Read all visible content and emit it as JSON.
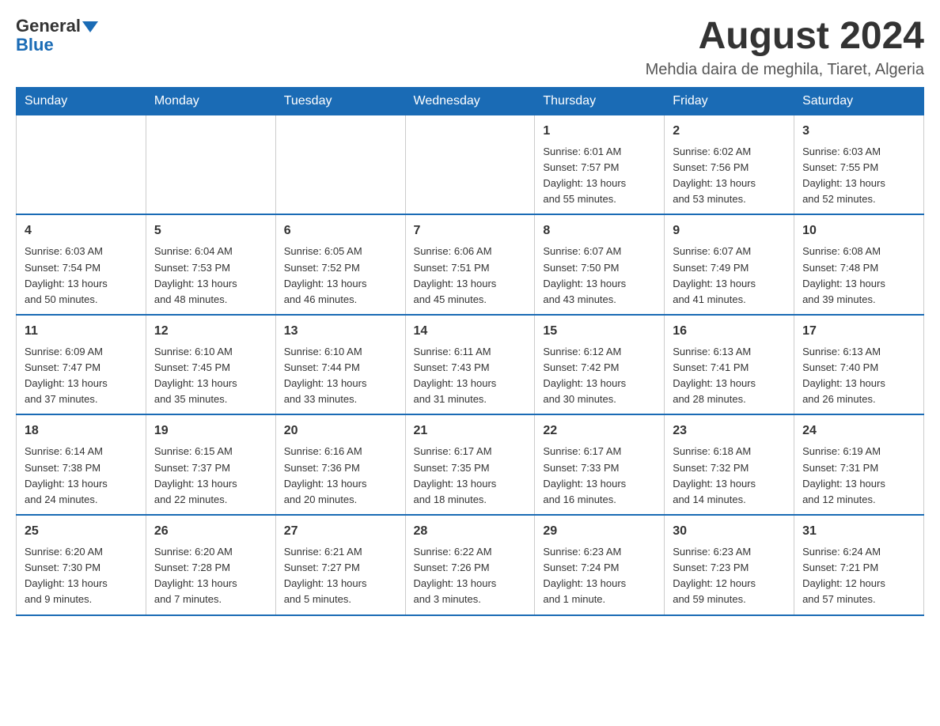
{
  "header": {
    "logo_general": "General",
    "logo_blue": "Blue",
    "title": "August 2024",
    "subtitle": "Mehdia daira de meghila, Tiaret, Algeria"
  },
  "days_of_week": [
    "Sunday",
    "Monday",
    "Tuesday",
    "Wednesday",
    "Thursday",
    "Friday",
    "Saturday"
  ],
  "weeks": [
    [
      {
        "day": "",
        "info": ""
      },
      {
        "day": "",
        "info": ""
      },
      {
        "day": "",
        "info": ""
      },
      {
        "day": "",
        "info": ""
      },
      {
        "day": "1",
        "info": "Sunrise: 6:01 AM\nSunset: 7:57 PM\nDaylight: 13 hours\nand 55 minutes."
      },
      {
        "day": "2",
        "info": "Sunrise: 6:02 AM\nSunset: 7:56 PM\nDaylight: 13 hours\nand 53 minutes."
      },
      {
        "day": "3",
        "info": "Sunrise: 6:03 AM\nSunset: 7:55 PM\nDaylight: 13 hours\nand 52 minutes."
      }
    ],
    [
      {
        "day": "4",
        "info": "Sunrise: 6:03 AM\nSunset: 7:54 PM\nDaylight: 13 hours\nand 50 minutes."
      },
      {
        "day": "5",
        "info": "Sunrise: 6:04 AM\nSunset: 7:53 PM\nDaylight: 13 hours\nand 48 minutes."
      },
      {
        "day": "6",
        "info": "Sunrise: 6:05 AM\nSunset: 7:52 PM\nDaylight: 13 hours\nand 46 minutes."
      },
      {
        "day": "7",
        "info": "Sunrise: 6:06 AM\nSunset: 7:51 PM\nDaylight: 13 hours\nand 45 minutes."
      },
      {
        "day": "8",
        "info": "Sunrise: 6:07 AM\nSunset: 7:50 PM\nDaylight: 13 hours\nand 43 minutes."
      },
      {
        "day": "9",
        "info": "Sunrise: 6:07 AM\nSunset: 7:49 PM\nDaylight: 13 hours\nand 41 minutes."
      },
      {
        "day": "10",
        "info": "Sunrise: 6:08 AM\nSunset: 7:48 PM\nDaylight: 13 hours\nand 39 minutes."
      }
    ],
    [
      {
        "day": "11",
        "info": "Sunrise: 6:09 AM\nSunset: 7:47 PM\nDaylight: 13 hours\nand 37 minutes."
      },
      {
        "day": "12",
        "info": "Sunrise: 6:10 AM\nSunset: 7:45 PM\nDaylight: 13 hours\nand 35 minutes."
      },
      {
        "day": "13",
        "info": "Sunrise: 6:10 AM\nSunset: 7:44 PM\nDaylight: 13 hours\nand 33 minutes."
      },
      {
        "day": "14",
        "info": "Sunrise: 6:11 AM\nSunset: 7:43 PM\nDaylight: 13 hours\nand 31 minutes."
      },
      {
        "day": "15",
        "info": "Sunrise: 6:12 AM\nSunset: 7:42 PM\nDaylight: 13 hours\nand 30 minutes."
      },
      {
        "day": "16",
        "info": "Sunrise: 6:13 AM\nSunset: 7:41 PM\nDaylight: 13 hours\nand 28 minutes."
      },
      {
        "day": "17",
        "info": "Sunrise: 6:13 AM\nSunset: 7:40 PM\nDaylight: 13 hours\nand 26 minutes."
      }
    ],
    [
      {
        "day": "18",
        "info": "Sunrise: 6:14 AM\nSunset: 7:38 PM\nDaylight: 13 hours\nand 24 minutes."
      },
      {
        "day": "19",
        "info": "Sunrise: 6:15 AM\nSunset: 7:37 PM\nDaylight: 13 hours\nand 22 minutes."
      },
      {
        "day": "20",
        "info": "Sunrise: 6:16 AM\nSunset: 7:36 PM\nDaylight: 13 hours\nand 20 minutes."
      },
      {
        "day": "21",
        "info": "Sunrise: 6:17 AM\nSunset: 7:35 PM\nDaylight: 13 hours\nand 18 minutes."
      },
      {
        "day": "22",
        "info": "Sunrise: 6:17 AM\nSunset: 7:33 PM\nDaylight: 13 hours\nand 16 minutes."
      },
      {
        "day": "23",
        "info": "Sunrise: 6:18 AM\nSunset: 7:32 PM\nDaylight: 13 hours\nand 14 minutes."
      },
      {
        "day": "24",
        "info": "Sunrise: 6:19 AM\nSunset: 7:31 PM\nDaylight: 13 hours\nand 12 minutes."
      }
    ],
    [
      {
        "day": "25",
        "info": "Sunrise: 6:20 AM\nSunset: 7:30 PM\nDaylight: 13 hours\nand 9 minutes."
      },
      {
        "day": "26",
        "info": "Sunrise: 6:20 AM\nSunset: 7:28 PM\nDaylight: 13 hours\nand 7 minutes."
      },
      {
        "day": "27",
        "info": "Sunrise: 6:21 AM\nSunset: 7:27 PM\nDaylight: 13 hours\nand 5 minutes."
      },
      {
        "day": "28",
        "info": "Sunrise: 6:22 AM\nSunset: 7:26 PM\nDaylight: 13 hours\nand 3 minutes."
      },
      {
        "day": "29",
        "info": "Sunrise: 6:23 AM\nSunset: 7:24 PM\nDaylight: 13 hours\nand 1 minute."
      },
      {
        "day": "30",
        "info": "Sunrise: 6:23 AM\nSunset: 7:23 PM\nDaylight: 12 hours\nand 59 minutes."
      },
      {
        "day": "31",
        "info": "Sunrise: 6:24 AM\nSunset: 7:21 PM\nDaylight: 12 hours\nand 57 minutes."
      }
    ]
  ]
}
